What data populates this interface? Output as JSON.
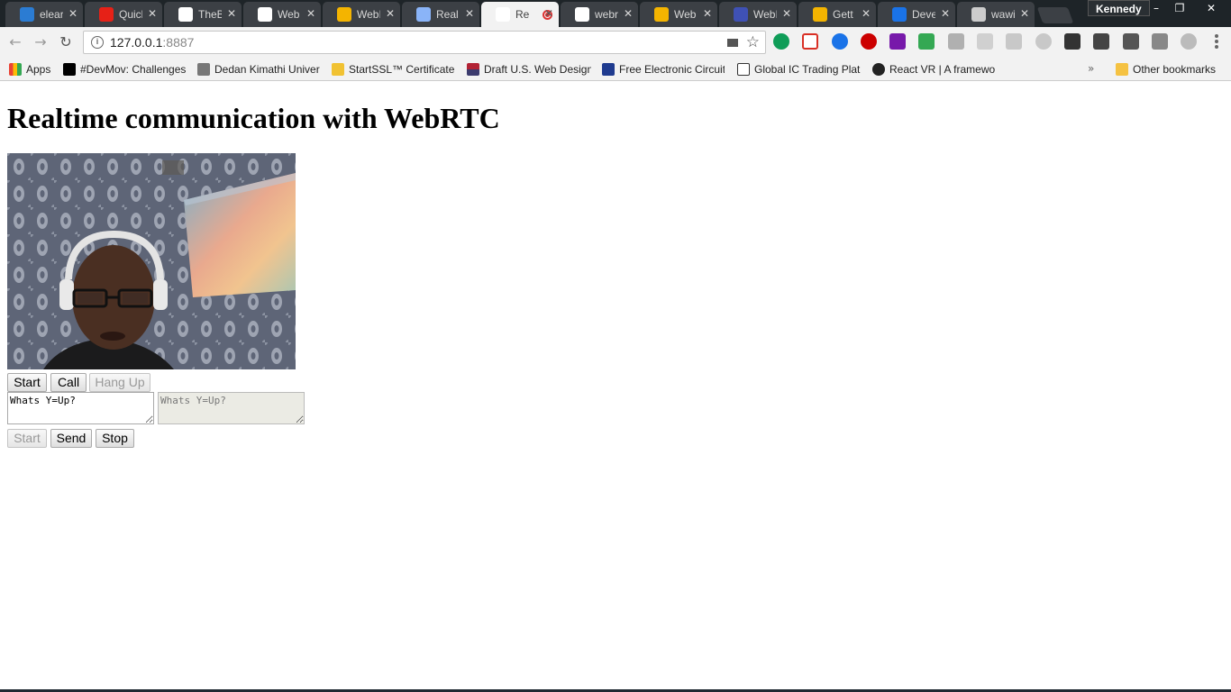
{
  "browser": {
    "tabs": [
      {
        "label": "elear",
        "icon": "onedrive-icon",
        "color": "#2b7cd3"
      },
      {
        "label": "Quick",
        "icon": "youtube-icon",
        "color": "#e62117"
      },
      {
        "label": "TheB",
        "icon": "github-icon",
        "color": "#ffffff"
      },
      {
        "label": "Web",
        "icon": "google-icon",
        "color": "#ffffff"
      },
      {
        "label": "WebI",
        "icon": "chrome-webstore-icon",
        "color": "#f4b400"
      },
      {
        "label": "Real",
        "icon": "page-icon",
        "color": "#8ab4f8"
      },
      {
        "label": "Re",
        "icon": "page-icon",
        "color": "#ffffff",
        "active": true
      },
      {
        "label": "webr",
        "icon": "github-icon",
        "color": "#ffffff"
      },
      {
        "label": "Web",
        "icon": "webstore-icon",
        "color": "#f4b400"
      },
      {
        "label": "WebI",
        "icon": "html5-icon",
        "color": "#3f51b5"
      },
      {
        "label": "Gett",
        "icon": "chrome-webstore-icon",
        "color": "#f4b400"
      },
      {
        "label": "Deve",
        "icon": "devtools-icon",
        "color": "#1a73e8"
      },
      {
        "label": "wawi",
        "icon": "page-icon",
        "color": "#cccccc"
      }
    ],
    "profile": "Kennedy",
    "window": {
      "minimize": "–",
      "restore": "❐",
      "close": "✕"
    },
    "address": {
      "host": "127.0.0.1",
      "port": ":8887"
    },
    "bookmarks": [
      {
        "label": "Apps",
        "icon": "apps-icon"
      },
      {
        "label": "#DevMov: Challenges",
        "icon": "medium-icon"
      },
      {
        "label": "Dedan Kimathi Univer",
        "icon": "person-icon"
      },
      {
        "label": "StartSSL™ Certificates",
        "icon": "certificate-icon"
      },
      {
        "label": "Draft U.S. Web Design",
        "icon": "us-flag-icon"
      },
      {
        "label": "Free Electronic Circuit",
        "icon": "circuit-icon"
      },
      {
        "label": "Global IC Trading Plat",
        "icon": "ic-trading-icon"
      },
      {
        "label": "React VR | A framewo",
        "icon": "react-icon"
      }
    ],
    "bookmarks_overflow": "»",
    "other_bookmarks": "Other bookmarks"
  },
  "page": {
    "title": "Realtime communication with WebRTC",
    "video_controls": {
      "start": "Start",
      "call": "Call",
      "hangup": "Hang Up"
    },
    "data_send_text": "Whats Y=Up?",
    "data_receive_text": "Whats Y=Up?",
    "data_controls": {
      "start": "Start",
      "send": "Send",
      "stop": "Stop"
    }
  }
}
